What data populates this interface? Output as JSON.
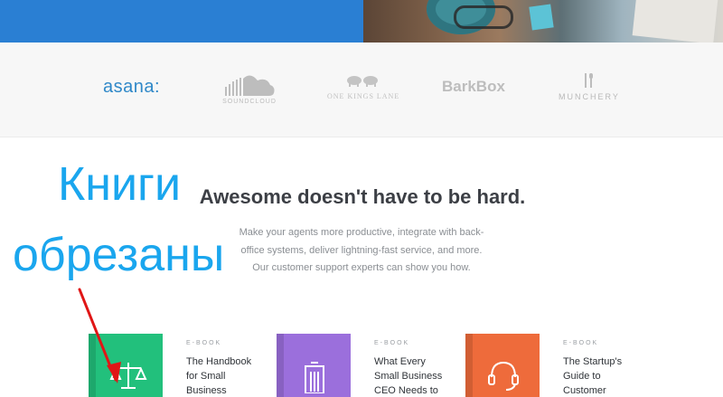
{
  "logos": {
    "asana": "asana:",
    "soundcloud": "SOUNDCLOUD",
    "one_kings_lane": "ONE KINGS LANE",
    "barkbox": "BarkBox",
    "munchery": "MUNCHERY"
  },
  "main": {
    "headline": "Awesome doesn't have to be hard.",
    "sub_lines": [
      "Make your agents more productive, integrate with back-",
      "office systems, deliver lightning-fast service, and more.",
      "Our customer support experts can show you how."
    ]
  },
  "annotation": {
    "line1": "Книги",
    "line2": "обрезаны",
    "color": "#1aa6ee",
    "arrow_color": "#e01616"
  },
  "ebooks": [
    {
      "label": "E-BOOK",
      "lines": [
        "The Handbook",
        "for Small",
        "Business"
      ],
      "color": "#22c07c",
      "icon": "scales-icon"
    },
    {
      "label": "E-BOOK",
      "lines": [
        "What Every",
        "Small Business",
        "CEO Needs to"
      ],
      "color": "#9b6fdc",
      "icon": "building-icon"
    },
    {
      "label": "E-BOOK",
      "lines": [
        "The Startup's",
        "Guide to",
        "Customer"
      ],
      "color": "#ee6b3b",
      "icon": "headset-icon"
    }
  ]
}
